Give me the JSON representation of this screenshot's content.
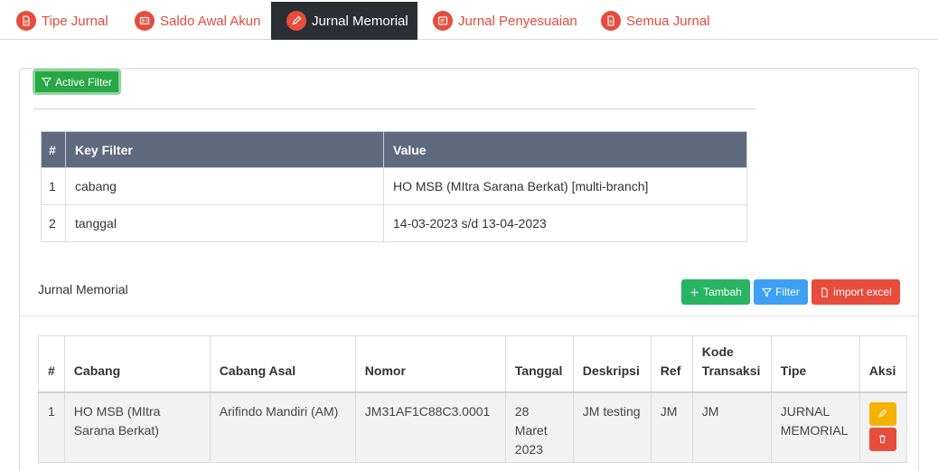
{
  "tabs": [
    {
      "label": "Tipe Jurnal",
      "icon": "document-icon",
      "active": false
    },
    {
      "label": "Saldo Awal Akun",
      "icon": "newspaper-icon",
      "active": false
    },
    {
      "label": "Jurnal Memorial",
      "icon": "pencil-icon",
      "active": true
    },
    {
      "label": "Jurnal Penyesuaian",
      "icon": "note-icon",
      "active": false
    },
    {
      "label": "Semua Jurnal",
      "icon": "document-icon",
      "active": false
    }
  ],
  "active_filter_button": "Active Filter",
  "filter_table": {
    "headers": [
      "#",
      "Key Filter",
      "Value"
    ],
    "rows": [
      [
        "1",
        "cabang",
        "HO MSB (MItra Sarana Berkat) [multi-branch]"
      ],
      [
        "2",
        "tanggal",
        "14-03-2023 s/d 13-04-2023"
      ]
    ]
  },
  "section_title": "Jurnal Memorial",
  "buttons": {
    "tambah": "Tambah",
    "filter": "Filter",
    "import": "import excel"
  },
  "data_table": {
    "headers": [
      "#",
      "Cabang",
      "Cabang Asal",
      "Nomor",
      "Tanggal",
      "Deskripsi",
      "Ref",
      "Kode Transaksi",
      "Tipe",
      "Aksi"
    ],
    "rows": [
      [
        "1",
        "HO MSB (MItra Sarana Berkat)",
        "Arifindo Mandiri (AM)",
        "JM31AF1C88C3.0001",
        "28 Maret 2023",
        "JM testing",
        "JM",
        "JM",
        "JURNAL MEMORIAL"
      ]
    ]
  },
  "colors": {
    "accent_red": "#e74c3c",
    "tab_active_bg": "#2b2f33",
    "green": "#28a745",
    "blue": "#3da0f5",
    "table_header": "#5e6b7f",
    "edit_yellow": "#f5b200"
  }
}
